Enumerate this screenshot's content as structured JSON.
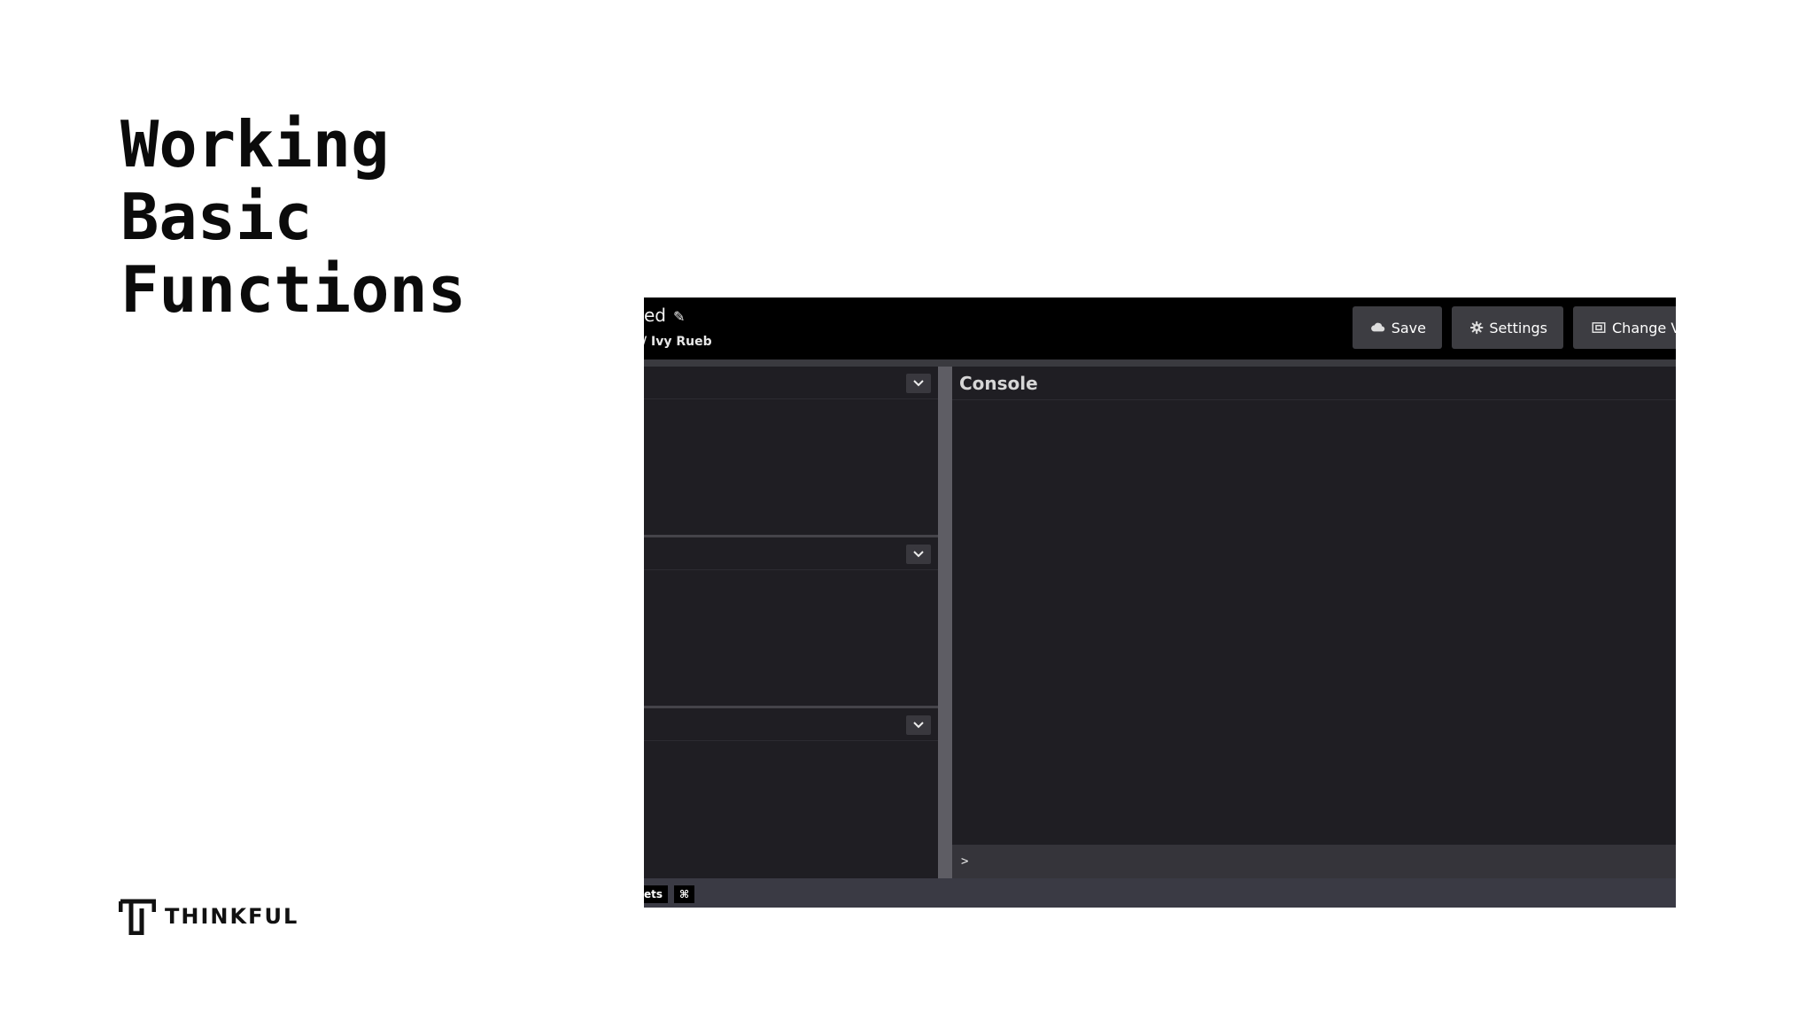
{
  "slide": {
    "title_lines": [
      "Working",
      "Basic",
      "Functions"
    ],
    "brand": "THINKFUL"
  },
  "ide": {
    "project_name": "ed",
    "project_author": "/ Ivy Rueb",
    "toolbar": {
      "save_label": "Save",
      "settings_label": "Settings",
      "change_view_label": "Change Vi"
    },
    "console": {
      "title": "Console",
      "prompt": ">"
    },
    "statusbar": {
      "assets_label": "ets",
      "shortcut_label": "⌘"
    }
  },
  "icons": {
    "save": "cloud-icon",
    "settings": "gear-icon",
    "change_view": "window-icon",
    "edit": "pencil-icon",
    "panel_toggle": "chevron-down-icon"
  }
}
